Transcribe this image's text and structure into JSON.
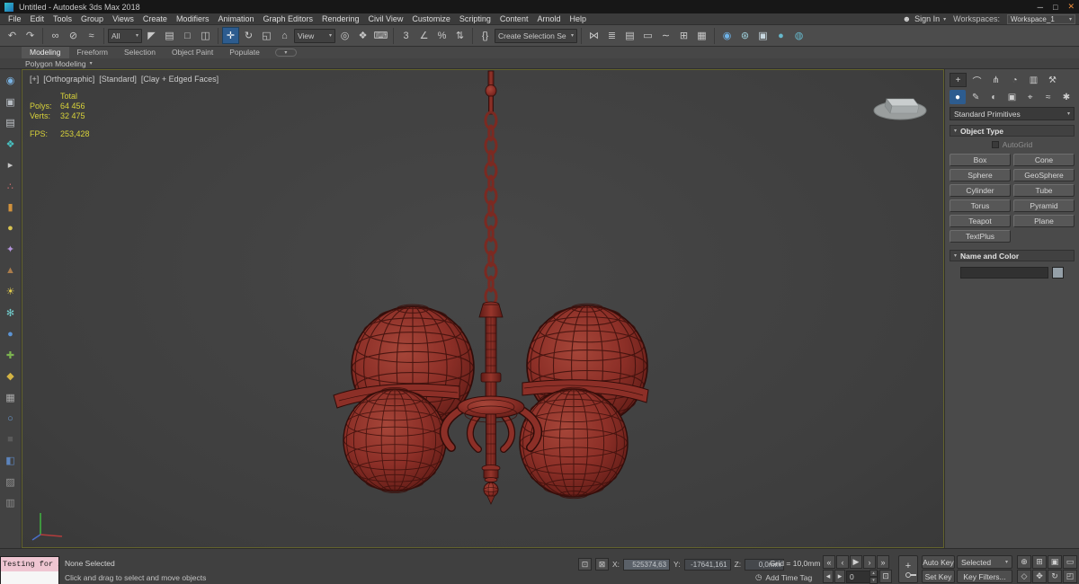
{
  "window": {
    "title": "Untitled - Autodesk 3ds Max 2018"
  },
  "icons": {
    "minimize": "─",
    "maximize": "□",
    "close": "✕",
    "caret": "▾",
    "person": "☻",
    "clock": "◷",
    "isolate": "⊡",
    "lock": "⊠",
    "time_config": "⊡",
    "spin_up": "▴",
    "spin_down": "▾"
  },
  "menu_bar": {
    "items": [
      "File",
      "Edit",
      "Tools",
      "Group",
      "Views",
      "Create",
      "Modifiers",
      "Animation",
      "Graph Editors",
      "Rendering",
      "Civil View",
      "Customize",
      "Scripting",
      "Content",
      "Arnold",
      "Help"
    ],
    "sign_in": "Sign In",
    "workspaces_label": "Workspaces:",
    "workspace_value": "Workspace_1"
  },
  "toolbar": {
    "selection_filter": "All",
    "reference_coordinate": "View",
    "named_selection": "Create Selection Se",
    "g_undo": [
      {
        "name": "undo-icon",
        "glyph": "↶"
      },
      {
        "name": "redo-icon",
        "glyph": "↷"
      }
    ],
    "g_link": [
      {
        "name": "select-link-icon",
        "glyph": "∞"
      },
      {
        "name": "unlink-icon",
        "glyph": "⊘"
      },
      {
        "name": "bind-spacewarp-icon",
        "glyph": "≈"
      }
    ],
    "g_select": [
      {
        "name": "select-object-icon",
        "glyph": "◤"
      },
      {
        "name": "select-by-name-icon",
        "glyph": "▤"
      },
      {
        "name": "rect-selection-region-icon",
        "glyph": "□"
      },
      {
        "name": "window-crossing-icon",
        "glyph": "◫"
      }
    ],
    "g_transform": [
      {
        "name": "select-move-icon",
        "glyph": "✛",
        "cls": "active"
      },
      {
        "name": "select-rotate-icon",
        "glyph": "↻"
      },
      {
        "name": "select-scale-icon",
        "glyph": "◱"
      },
      {
        "name": "select-place-icon",
        "glyph": "⌂"
      }
    ],
    "g_pivot": [
      {
        "name": "use-pivot-center-icon",
        "glyph": "◎"
      },
      {
        "name": "select-manipulate-icon",
        "glyph": "❖"
      },
      {
        "name": "keyboard-override-icon",
        "glyph": "⌨"
      }
    ],
    "g_snap": [
      {
        "name": "snap-toggle-3d-icon",
        "glyph": "3"
      },
      {
        "name": "angle-snap-icon",
        "glyph": "∠"
      },
      {
        "name": "percent-snap-icon",
        "glyph": "%"
      },
      {
        "name": "spinner-snap-icon",
        "glyph": "⇅"
      }
    ],
    "g_sets": [
      {
        "name": "edit-named-sets-icon",
        "glyph": "{}"
      }
    ],
    "g_tools": [
      {
        "name": "mirror-icon",
        "glyph": "⋈"
      },
      {
        "name": "align-icon",
        "glyph": "≣"
      },
      {
        "name": "layer-explorer-icon",
        "glyph": "▤"
      },
      {
        "name": "ribbon-toggle-icon",
        "glyph": "▭"
      },
      {
        "name": "curve-editor-icon",
        "glyph": "∼"
      },
      {
        "name": "schematic-view-icon",
        "glyph": "⊞"
      },
      {
        "name": "scene-explorer-icon",
        "glyph": "▦"
      }
    ],
    "g_render": [
      {
        "name": "material-editor-icon",
        "glyph": "◉",
        "color": "#6fb3e8"
      },
      {
        "name": "render-setup-icon",
        "glyph": "⊛",
        "color": "#9fd0dc"
      },
      {
        "name": "rendered-frame-icon",
        "glyph": "▣",
        "color": "#c8d8e0"
      },
      {
        "name": "render-production-icon",
        "glyph": "●",
        "color": "#66b8cc"
      },
      {
        "name": "render-iterative-icon",
        "glyph": "◍",
        "color": "#66b8cc"
      }
    ]
  },
  "ribbon": {
    "tabs": [
      {
        "label": "Modeling",
        "name": "tab-modeling",
        "cls": "active"
      },
      {
        "label": "Freeform",
        "name": "tab-freeform"
      },
      {
        "label": "Selection",
        "name": "tab-selection"
      },
      {
        "label": "Object Paint",
        "name": "tab-object-paint"
      },
      {
        "label": "Populate",
        "name": "tab-populate"
      }
    ],
    "panel": "Polygon Modeling"
  },
  "left_toolbar": [
    {
      "name": "viewport-config-icon",
      "glyph": "◉",
      "color": "#79b2e2"
    },
    {
      "name": "image-icon",
      "glyph": "▣",
      "color": "#b6bcc2"
    },
    {
      "name": "notes-icon",
      "glyph": "▤",
      "color": "#c2c6ca"
    },
    {
      "name": "palette-icon",
      "glyph": "❖",
      "color": "#48c2c2"
    },
    {
      "name": "cursor-icon",
      "glyph": "▸",
      "color": "#c8c8c8"
    },
    {
      "name": "particles-icon",
      "glyph": "∴",
      "color": "#d27070"
    },
    {
      "name": "cylinder-icon",
      "glyph": "▮",
      "color": "#d2923c"
    },
    {
      "name": "sphere-icon",
      "glyph": "●",
      "color": "#d8c452"
    },
    {
      "name": "star-icon",
      "glyph": "✦",
      "color": "#b494dc"
    },
    {
      "name": "cone-icon",
      "glyph": "▲",
      "color": "#aa7c4c"
    },
    {
      "name": "sun-icon",
      "glyph": "☀",
      "color": "#e2cc4e"
    },
    {
      "name": "snowflake-icon",
      "glyph": "✻",
      "color": "#72cccc"
    },
    {
      "name": "drop-icon",
      "glyph": "●",
      "color": "#5c94d4"
    },
    {
      "name": "move-arrows-icon",
      "glyph": "✚",
      "color": "#7cb450"
    },
    {
      "name": "gem-icon",
      "glyph": "◆",
      "color": "#d4b444"
    },
    {
      "name": "grid-icon",
      "glyph": "▦",
      "color": "#aaaaaa"
    },
    {
      "name": "ring-icon",
      "glyph": "○",
      "color": "#6c9cd4"
    },
    {
      "name": "dark-box-icon",
      "glyph": "■",
      "color": "#5a5a5a"
    },
    {
      "name": "cube-icon",
      "glyph": "◧",
      "color": "#5c84bc"
    },
    {
      "name": "hatch-icon",
      "glyph": "▨",
      "color": "#949494"
    },
    {
      "name": "box-icon",
      "glyph": "▥",
      "color": "#8c8c8c"
    }
  ],
  "viewport": {
    "menus": {
      "plus": "[+]",
      "pov": "[Orthographic]",
      "standard": "[Standard]",
      "shading": "[Clay + Edged Faces]"
    },
    "stats": {
      "total": "Total",
      "polys_label": "Polys:",
      "polys_value": "64 456",
      "verts_label": "Verts:",
      "verts_value": "32 475",
      "fps_label": "FPS:",
      "fps_value": "253,428"
    }
  },
  "command_panel": {
    "tabs_main": [
      {
        "name": "create-tab-icon",
        "glyph": "+",
        "cls": "active"
      },
      {
        "name": "modify-tab-icon",
        "glyph": "⌒"
      },
      {
        "name": "hierarchy-tab-icon",
        "glyph": "⋔"
      },
      {
        "name": "motion-tab-icon",
        "glyph": "◔"
      },
      {
        "name": "display-tab-icon",
        "glyph": "▥"
      },
      {
        "name": "utilities-tab-icon",
        "glyph": "⚒"
      }
    ],
    "tabs_category": [
      {
        "name": "geometry-category-icon",
        "glyph": "●",
        "cls": "active2"
      },
      {
        "name": "shapes-category-icon",
        "glyph": "✎"
      },
      {
        "name": "lights-category-icon",
        "glyph": "◐"
      },
      {
        "name": "cameras-category-icon",
        "glyph": "▣"
      },
      {
        "name": "helpers-category-icon",
        "glyph": "⌖"
      },
      {
        "name": "spacewarps-category-icon",
        "glyph": "≈"
      },
      {
        "name": "systems-category-icon",
        "glyph": "✱"
      }
    ],
    "category_dropdown": "Standard Primitives",
    "rollout_object_type": "Object Type",
    "autogrid": "AutoGrid",
    "object_buttons": [
      {
        "label": "Box",
        "name": "box-button"
      },
      {
        "label": "Cone",
        "name": "cone-button"
      },
      {
        "label": "Sphere",
        "name": "sphere-button"
      },
      {
        "label": "GeoSphere",
        "name": "geosphere-button"
      },
      {
        "label": "Cylinder",
        "name": "cylinder-button"
      },
      {
        "label": "Tube",
        "name": "tube-button"
      },
      {
        "label": "Torus",
        "name": "torus-button"
      },
      {
        "label": "Pyramid",
        "name": "pyramid-button"
      },
      {
        "label": "Teapot",
        "name": "teapot-button"
      },
      {
        "label": "Plane",
        "name": "plane-button"
      },
      {
        "label": "TextPlus",
        "name": "textplus-button"
      }
    ],
    "rollout_name_color": "Name and Color"
  },
  "status_bar": {
    "maxscript": "Testing for i",
    "selection": "None Selected",
    "prompt": "Click and drag to select and move objects",
    "x_label": "X:",
    "x_value": "525374,63",
    "y_label": "Y:",
    "y_value": "-17641,161",
    "z_label": "Z:",
    "z_value": "0,0mm",
    "grid": "Grid = 10,0mm",
    "add_time_tag": "Add Time Tag",
    "auto_key": "Auto Key",
    "set_key": "Set Key",
    "selected": "Selected",
    "key_filters": "Key Filters...",
    "frame": "0",
    "playback": [
      {
        "name": "go-to-start-button",
        "glyph": "«"
      },
      {
        "name": "previous-frame-button",
        "glyph": "‹"
      },
      {
        "name": "play-button",
        "glyph": "▶"
      },
      {
        "name": "next-frame-button",
        "glyph": "›"
      },
      {
        "name": "go-to-end-button",
        "glyph": "»"
      }
    ],
    "frame_steps": [
      {
        "name": "frame-back-button",
        "glyph": "◂"
      },
      {
        "name": "frame-forward-button",
        "glyph": "▸"
      }
    ],
    "nav_row1": [
      {
        "name": "zoom-icon",
        "glyph": "⊕"
      },
      {
        "name": "zoom-all-icon",
        "glyph": "⊞"
      },
      {
        "name": "zoom-extents-icon",
        "glyph": "▣"
      },
      {
        "name": "zoom-region-icon",
        "glyph": "▭"
      }
    ],
    "nav_row2": [
      {
        "name": "fov-icon",
        "glyph": "◇"
      },
      {
        "name": "pan-icon",
        "glyph": "✥"
      },
      {
        "name": "orbit-icon",
        "glyph": "↻"
      },
      {
        "name": "maximize-viewport-icon",
        "glyph": "◰"
      }
    ]
  }
}
